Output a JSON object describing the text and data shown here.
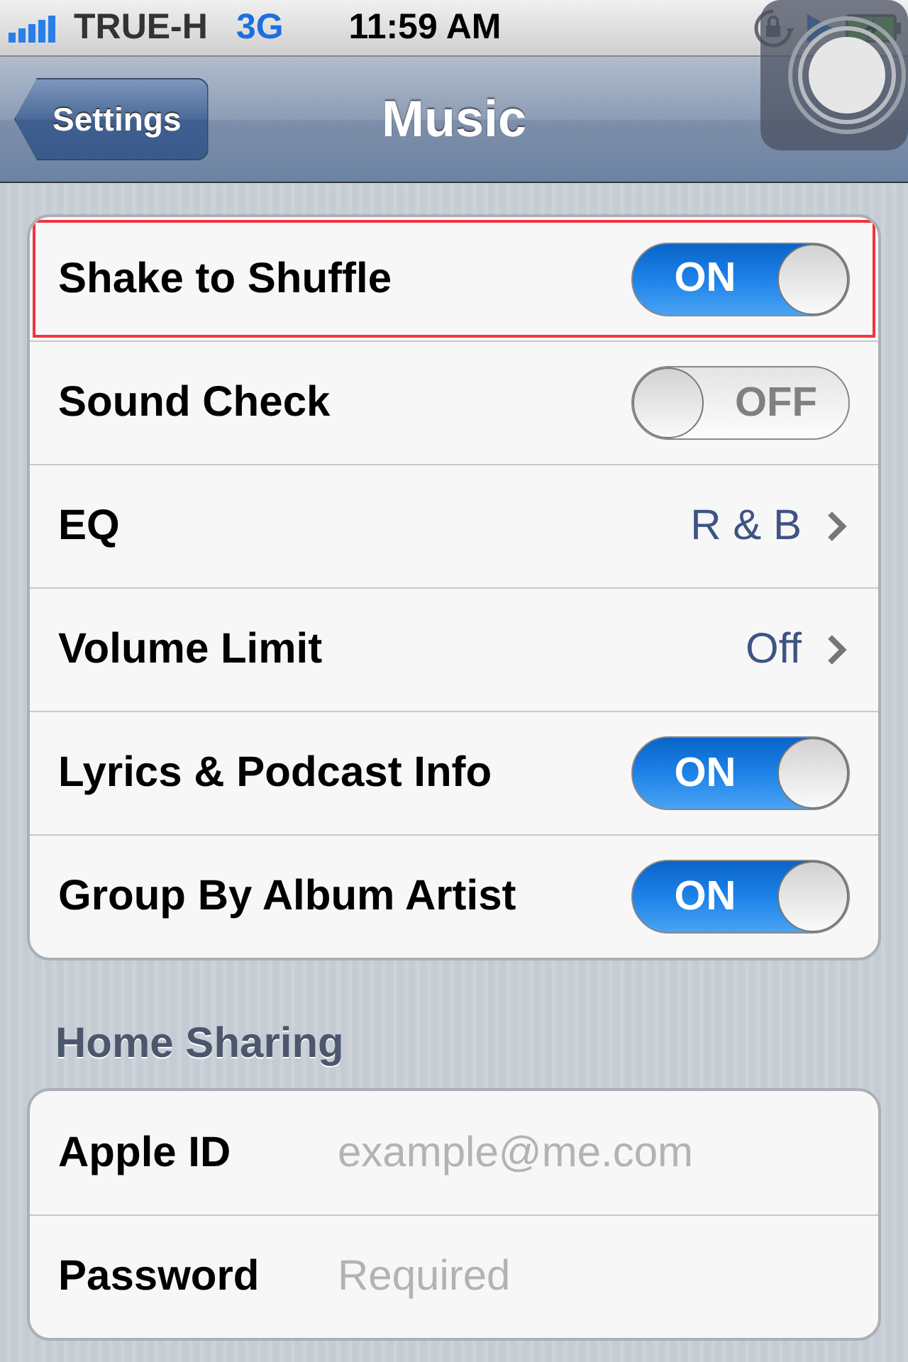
{
  "status_bar": {
    "carrier": "TRUE-H",
    "network": "3G",
    "time": "11:59 AM"
  },
  "nav_bar": {
    "back": "Settings",
    "title": "Music"
  },
  "settings": [
    {
      "kind": "toggle",
      "label": "Shake to Shuffle",
      "on": true,
      "switch_text": "ON",
      "highlighted": true
    },
    {
      "kind": "toggle",
      "label": "Sound Check",
      "on": false,
      "switch_text": "OFF",
      "highlighted": false
    },
    {
      "kind": "disclosure",
      "label": "EQ",
      "value": "R & B",
      "highlighted": false
    },
    {
      "kind": "disclosure",
      "label": "Volume Limit",
      "value": "Off",
      "highlighted": false
    },
    {
      "kind": "toggle",
      "label": "Lyrics & Podcast Info",
      "on": true,
      "switch_text": "ON",
      "highlighted": false
    },
    {
      "kind": "toggle",
      "label": "Group By Album Artist",
      "on": true,
      "switch_text": "ON",
      "highlighted": false
    }
  ],
  "home_sharing": {
    "header": "Home Sharing",
    "fields": [
      {
        "label": "Apple ID",
        "placeholder": "example@me.com"
      },
      {
        "label": "Password",
        "placeholder": "Required"
      }
    ]
  }
}
